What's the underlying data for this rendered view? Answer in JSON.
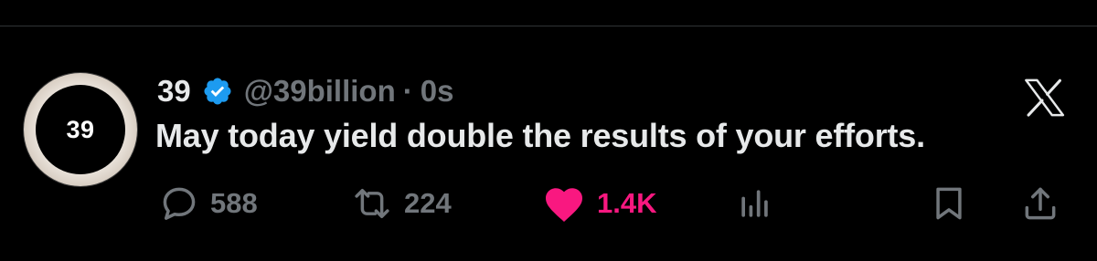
{
  "tweet": {
    "avatar_text": "39",
    "display_name": "39",
    "handle": "@39billion",
    "separator": "·",
    "time": "0s",
    "text": "May today yield double the results of your efforts."
  },
  "actions": {
    "replies": "588",
    "reposts": "224",
    "likes": "1.4K"
  },
  "icons": {
    "verified": "verified-badge-icon",
    "brand": "x-logo-icon",
    "reply": "reply-icon",
    "repost": "repost-icon",
    "like": "heart-icon",
    "views": "views-icon",
    "bookmark": "bookmark-icon",
    "share": "share-icon"
  },
  "colors": {
    "background": "#000000",
    "text_primary": "#e7e9ea",
    "text_secondary": "#71767b",
    "like": "#f91880",
    "verified": "#1d9bf0",
    "divider": "#2f3336"
  }
}
